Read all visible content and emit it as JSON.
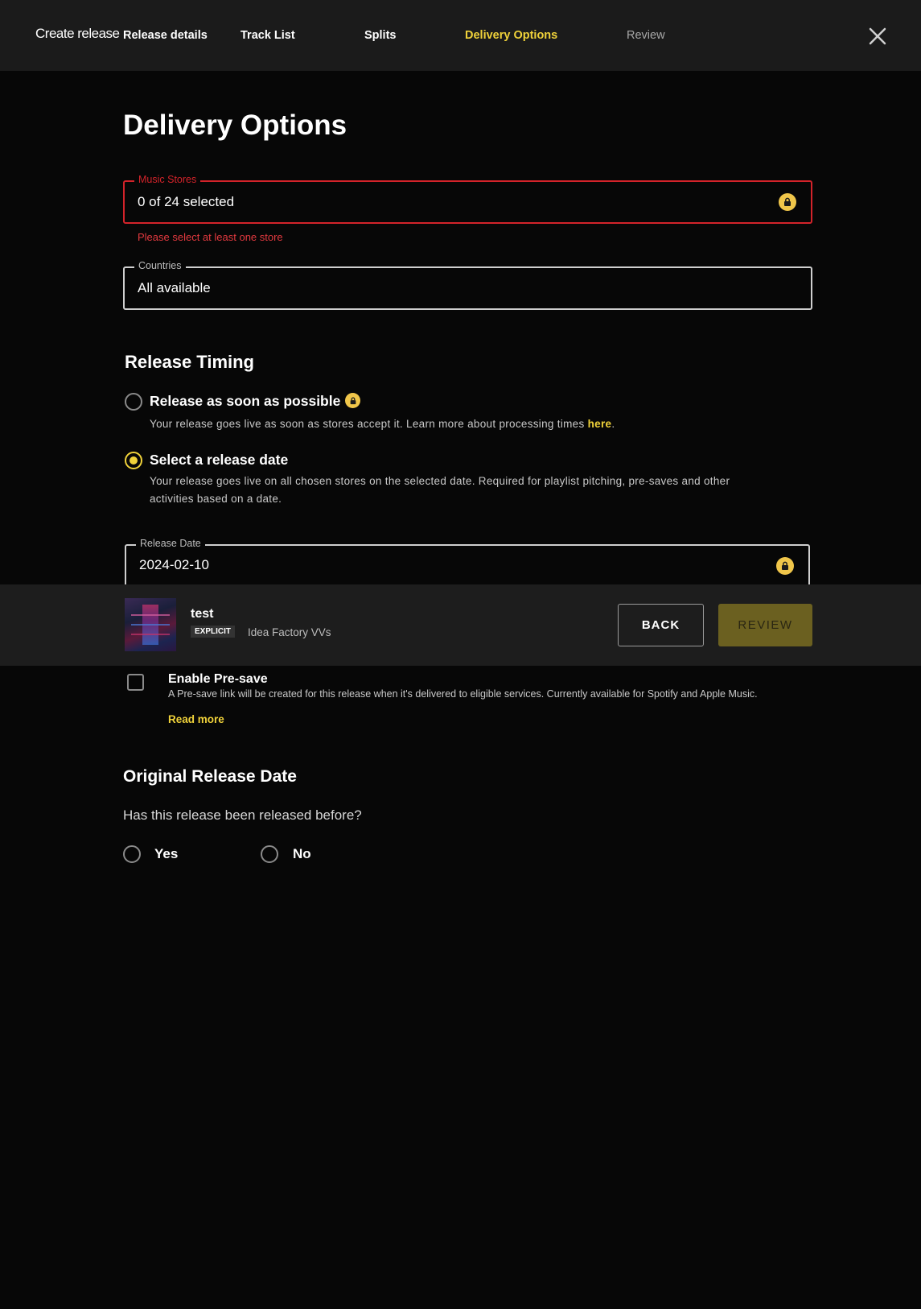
{
  "header": {
    "brand": "Create release",
    "steps": [
      {
        "label": "Release details",
        "state": "done"
      },
      {
        "label": "Track List",
        "state": "done"
      },
      {
        "label": "Splits",
        "state": "done"
      },
      {
        "label": "Delivery Options",
        "state": "active"
      },
      {
        "label": "Review",
        "state": "pending"
      }
    ]
  },
  "page": {
    "title": "Delivery Options"
  },
  "music_stores": {
    "legend": "Music Stores",
    "value": "0 of 24 selected",
    "error": "Please select at least one store"
  },
  "countries": {
    "legend": "Countries",
    "value": "All available"
  },
  "release_timing": {
    "title": "Release Timing",
    "asap": {
      "label": "Release as soon as possible",
      "desc_prefix": "Your release goes live as soon as stores accept it. Learn more about processing times ",
      "link": "here",
      "desc_suffix": ".",
      "selected": false
    },
    "date": {
      "label": "Select a release date",
      "desc_line1": "Your release goes live on all chosen stores on the selected date. Required for playlist pitching, pre-saves and other",
      "desc_line2": "activities based on a date.",
      "selected": true
    },
    "release_date": {
      "legend": "Release Date",
      "value": "2024-02-10"
    }
  },
  "release_bar": {
    "title": "test",
    "explicit": "EXPLICIT",
    "artist": "Idea Factory VVs",
    "back_label": "BACK",
    "review_label": "REVIEW"
  },
  "presave": {
    "label": "Enable Pre-save",
    "desc": "A Pre-save link will be created for this release when it's delivered to eligible services. Currently available for Spotify and Apple Music.",
    "read_more": "Read more",
    "checked": false
  },
  "original_release": {
    "title": "Original Release Date",
    "question": "Has this release been released before?",
    "yes": "Yes",
    "no": "No"
  },
  "colors": {
    "accent": "#f0d23a",
    "error": "#d3232a",
    "lock": "#f0c64a",
    "background": "#070707",
    "topbar": "#1b1b1b"
  }
}
